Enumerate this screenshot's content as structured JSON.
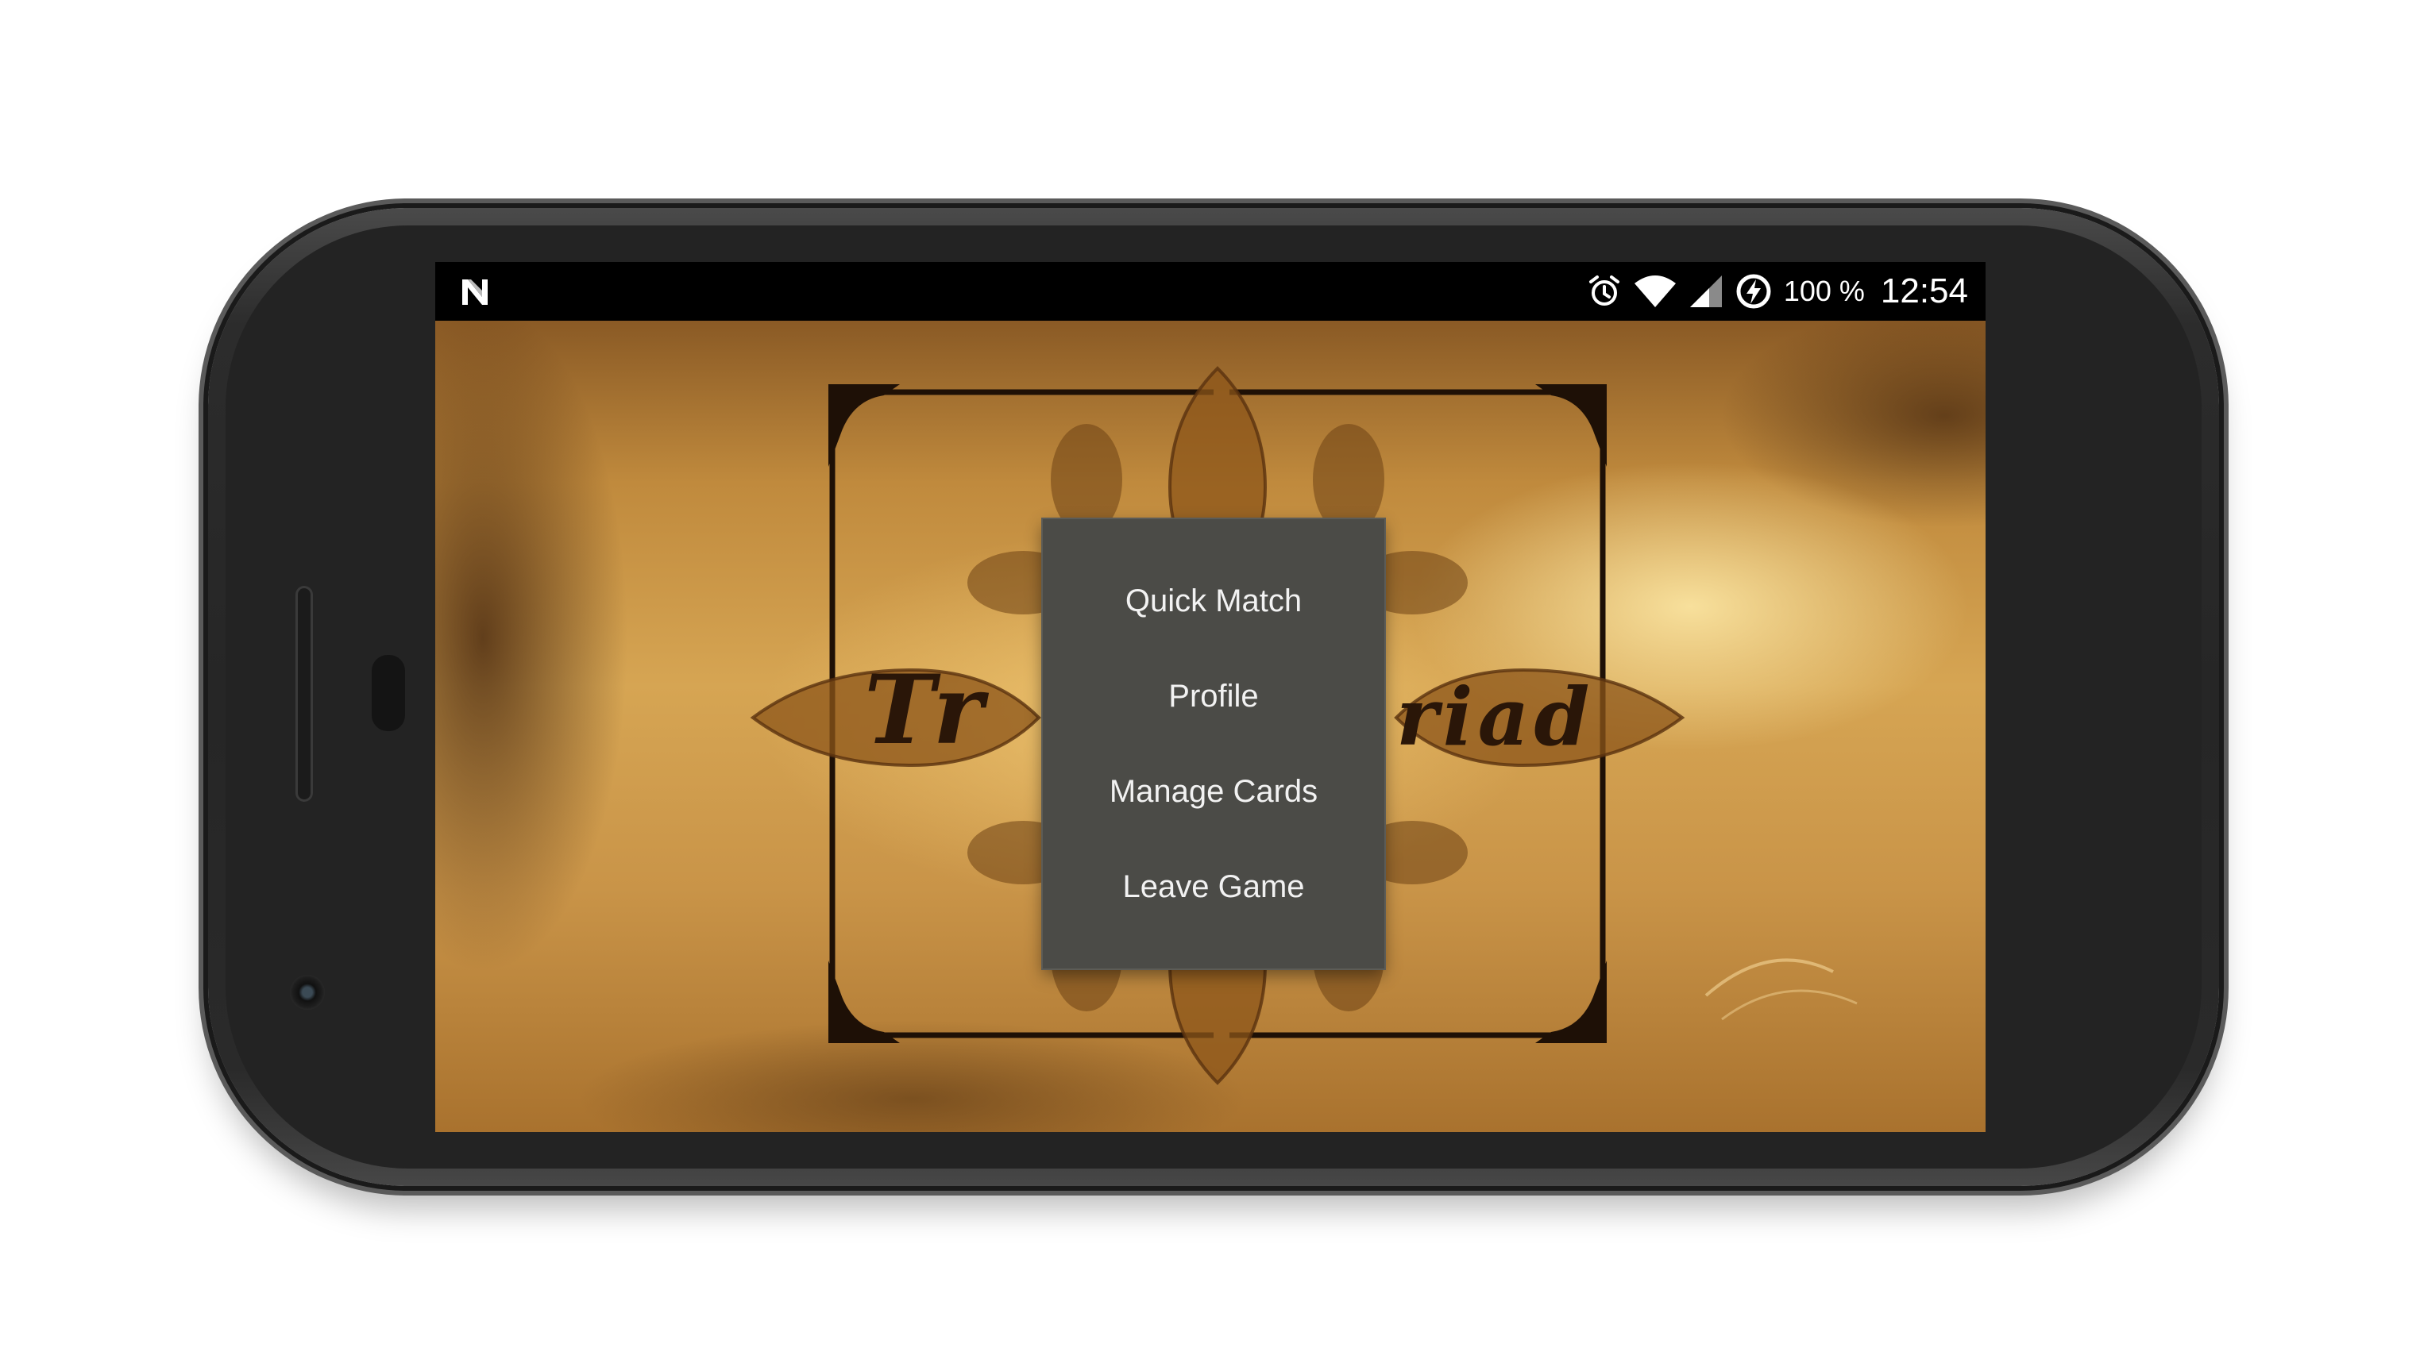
{
  "status_bar": {
    "battery_percent": "100 %",
    "time": "12:54",
    "icons": [
      "n-notification-icon",
      "alarm-icon",
      "wifi-icon",
      "cell-signal-icon",
      "battery-saver-icon"
    ]
  },
  "game": {
    "logo_text_left": "Tr",
    "logo_text_right": "riad"
  },
  "menu": {
    "items": [
      {
        "label": "Quick Match"
      },
      {
        "label": "Profile"
      },
      {
        "label": "Manage Cards"
      },
      {
        "label": "Leave Game"
      }
    ]
  },
  "colors": {
    "menu_bg": "#4b4b47",
    "menu_text": "#f2f2f2",
    "status_bar_bg": "#000000",
    "phone_body": "#262626"
  }
}
